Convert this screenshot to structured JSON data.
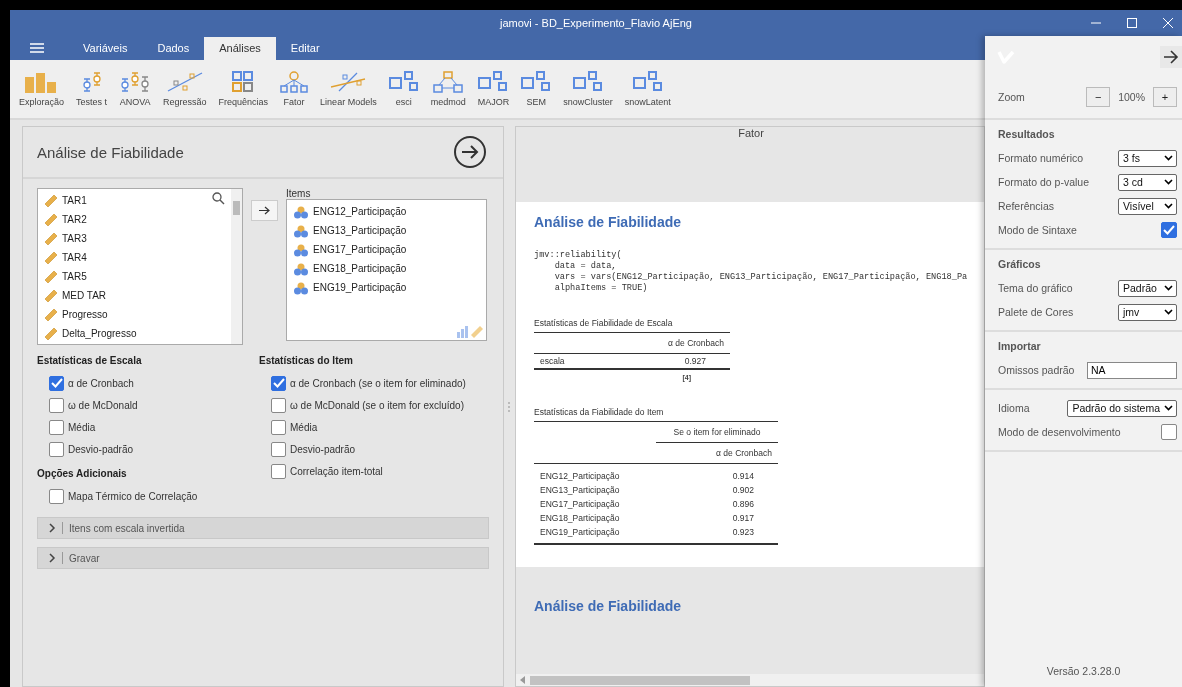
{
  "window": {
    "title": "jamovi - BD_Experimento_Flavio AjEng"
  },
  "menu_tabs": [
    {
      "label": "Variáveis",
      "selected": false
    },
    {
      "label": "Dados",
      "selected": false
    },
    {
      "label": "Análises",
      "selected": true
    },
    {
      "label": "Editar",
      "selected": false
    }
  ],
  "toolbar": [
    {
      "label": "Exploração",
      "kind": "exploration"
    },
    {
      "label": "Testes t",
      "kind": "ttest"
    },
    {
      "label": "ANOVA",
      "kind": "anova"
    },
    {
      "label": "Regressão",
      "kind": "regression"
    },
    {
      "label": "Frequências",
      "kind": "frequencies"
    },
    {
      "label": "Fator",
      "kind": "factor"
    },
    {
      "label": "Linear Models",
      "kind": "linear"
    },
    {
      "label": "esci",
      "kind": "module"
    },
    {
      "label": "medmod",
      "kind": "medmod"
    },
    {
      "label": "MAJOR",
      "kind": "module"
    },
    {
      "label": "SEM",
      "kind": "module"
    },
    {
      "label": "snowCluster",
      "kind": "module"
    },
    {
      "label": "snowLatent",
      "kind": "module"
    }
  ],
  "analysis": {
    "title": "Análise de Fiabilidade",
    "variables": [
      {
        "name": "TAR1"
      },
      {
        "name": "TAR2"
      },
      {
        "name": "TAR3"
      },
      {
        "name": "TAR4"
      },
      {
        "name": "TAR5"
      },
      {
        "name": "MED TAR"
      },
      {
        "name": "Progresso"
      },
      {
        "name": "Delta_Progresso"
      }
    ],
    "items_label": "Items",
    "items": [
      {
        "name": "ENG12_Participação"
      },
      {
        "name": "ENG13_Participação"
      },
      {
        "name": "ENG17_Participação"
      },
      {
        "name": "ENG18_Participação"
      },
      {
        "name": "ENG19_Participação"
      }
    ],
    "option_groups": [
      {
        "heading": "Estatísticas de Escala",
        "options": [
          {
            "label": "α de Cronbach",
            "checked": true
          },
          {
            "label": "ω de McDonald",
            "checked": false
          },
          {
            "label": "Média",
            "checked": false
          },
          {
            "label": "Desvio-padrão",
            "checked": false
          }
        ]
      },
      {
        "heading": "Estatísticas do Item",
        "options": [
          {
            "label": "α de Cronbach (se o item for eliminado)",
            "checked": true
          },
          {
            "label": "ω de McDonald (se o item for excluído)",
            "checked": false
          },
          {
            "label": "Média",
            "checked": false
          },
          {
            "label": "Desvio-padrão",
            "checked": false
          },
          {
            "label": "Correlação item-total",
            "checked": false
          }
        ]
      },
      {
        "heading": "Opções Adicionais",
        "options": [
          {
            "label": "Mapa Térmico de Correlação",
            "checked": false
          }
        ]
      }
    ],
    "sections": [
      {
        "label": "Itens com escala invertida",
        "expanded": false
      },
      {
        "label": "Gravar",
        "expanded": false
      }
    ]
  },
  "results": {
    "previous_title": "Fator",
    "title": "Análise de Fiabilidade",
    "syntax": [
      "jmv::reliability(",
      "    data = data,",
      "    vars = vars(ENG12_Participação, ENG13_Participação, ENG17_Participação, ENG18_Pa",
      "    alphaItems = TRUE)"
    ],
    "scale_table": {
      "title": "Estatísticas de Fiabilidade de Escala",
      "column": "α de Cronbach",
      "rows": [
        {
          "label": "escala",
          "value": "0.927"
        }
      ],
      "note": "[4]"
    },
    "item_table": {
      "title": "Estatísticas da Fiabilidade do Item",
      "group_header": "Se o item for eliminado",
      "column": "α de Cronbach",
      "rows": [
        {
          "label": "ENG12_Participação",
          "value": "0.914"
        },
        {
          "label": "ENG13_Participação",
          "value": "0.902"
        },
        {
          "label": "ENG17_Participação",
          "value": "0.896"
        },
        {
          "label": "ENG18_Participação",
          "value": "0.917"
        },
        {
          "label": "ENG19_Participação",
          "value": "0.923"
        }
      ]
    },
    "next_title": "Análise de Fiabilidade"
  },
  "settings": {
    "zoom": {
      "label": "Zoom",
      "minus": "−",
      "value": "100%",
      "plus": "+"
    },
    "groups": [
      {
        "heading": "Resultados",
        "rows": [
          {
            "kind": "select",
            "label": "Formato numérico",
            "value": "3 fs"
          },
          {
            "kind": "select",
            "label": "Formato do p-value",
            "value": "3 cd"
          },
          {
            "kind": "select",
            "label": "Referências",
            "value": "Visível"
          },
          {
            "kind": "checkbox",
            "label": "Modo de Sintaxe",
            "checked": true
          }
        ]
      },
      {
        "heading": "Gráficos",
        "rows": [
          {
            "kind": "select",
            "label": "Tema do gráfico",
            "value": "Padrão"
          },
          {
            "kind": "select",
            "label": "Palete de Cores",
            "value": "jmv"
          }
        ]
      },
      {
        "heading": "Importar",
        "rows": [
          {
            "kind": "input",
            "label": "Omissos padrão",
            "value": "NA"
          }
        ]
      },
      {
        "rows": [
          {
            "kind": "select",
            "label": "Idioma",
            "value": "Padrão do sistema"
          },
          {
            "kind": "checkbox",
            "label": "Modo de desenvolvimento",
            "checked": false
          }
        ]
      }
    ],
    "version": "Versão 2.3.28.0"
  }
}
